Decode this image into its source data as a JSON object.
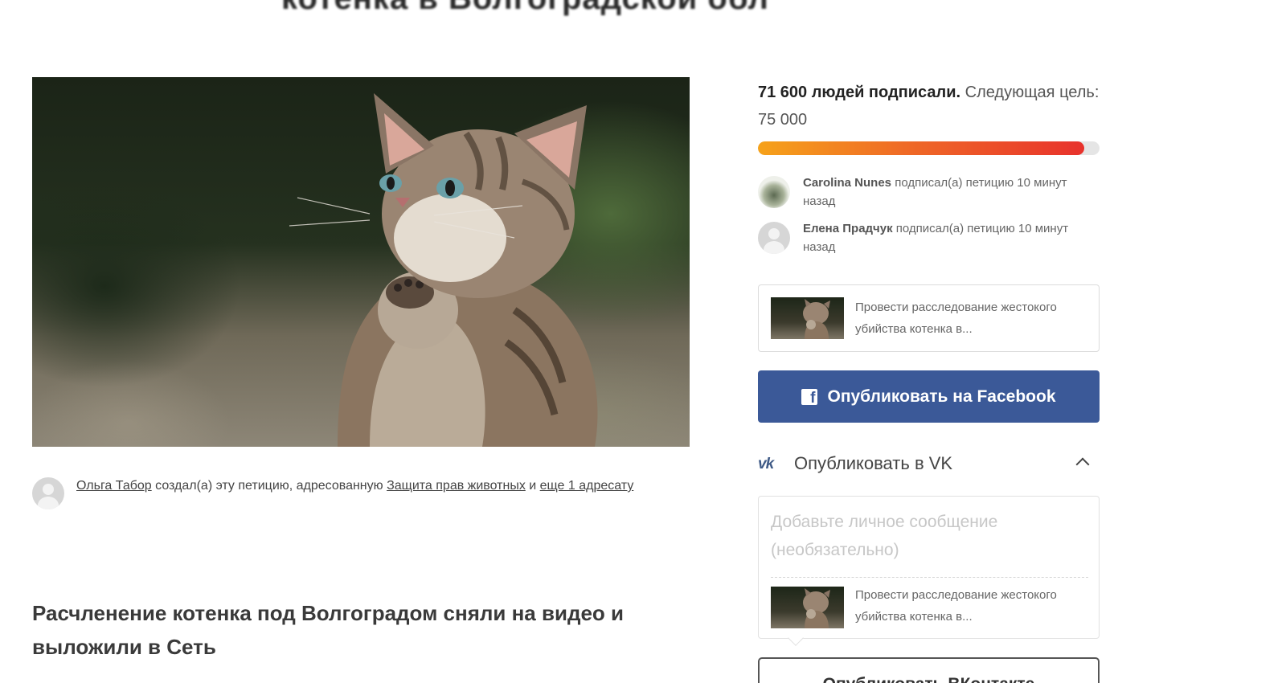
{
  "page": {
    "title": "котенка в Волгоградской обл"
  },
  "author": {
    "name": "Ольга Табор",
    "text_created": " создал(а) эту петицию, адресованную ",
    "target": "Защита прав животных",
    "text_and": " и ",
    "more_link": "еще 1 адресату"
  },
  "story": {
    "heading": "Расчленение котенка под Волгоградом сняли на видео и выложили в Сеть"
  },
  "signatures": {
    "count_bold": "71 600 людей подписали.",
    "next_goal": " Следующая цель: 75 000",
    "current": 71600,
    "goal": 75000,
    "progress_fraction": 0.955
  },
  "recent_signers": [
    {
      "name": "Carolina Nunes",
      "action": " подписал(а) петицию 10 минут назад"
    },
    {
      "name": "Елена Прадчук",
      "action": " подписал(а) петицию 10 минут назад"
    }
  ],
  "share": {
    "card_text": "Провести расследование жестокого убийства котенка в...",
    "facebook_label": "Опубликовать на Facebook",
    "vk_label": "Опубликовать в VK",
    "vk_placeholder": "Добавьте личное сообщение (необязательно)",
    "vk_card_text": "Провести расследование жестокого убийства котенка в...",
    "vk_publish_label": "Опубликовать ВКонтакте"
  },
  "colors": {
    "facebook": "#3b5998",
    "vk": "#3f5a86",
    "progress_start": "#f6a21a",
    "progress_end": "#e8322c"
  },
  "icons": {
    "facebook": "facebook-icon",
    "vk": "vk-icon",
    "chevron": "chevron-up-icon",
    "avatar": "user-avatar"
  }
}
